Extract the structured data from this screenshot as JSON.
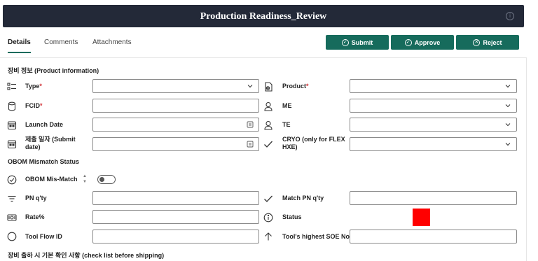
{
  "header": {
    "title": "Production Readiness_Review"
  },
  "tabs": [
    {
      "label": "Details"
    },
    {
      "label": "Comments"
    },
    {
      "label": "Attachments"
    }
  ],
  "actions": {
    "submit": "Submit",
    "approve": "Approve",
    "reject": "Reject"
  },
  "sections": {
    "product_info": "장비 정보 (Product information)",
    "obom": "OBOM Mismatch Status",
    "checklist": "장비 출하 시 기본 확인 사항 (check list before shipping)"
  },
  "fields": {
    "type": {
      "label": "Type",
      "required": "*",
      "value": ""
    },
    "product": {
      "label": "Product",
      "required": "*",
      "value": ""
    },
    "fcid": {
      "label": "FCID",
      "required": "*",
      "value": ""
    },
    "me": {
      "label": "ME",
      "value": ""
    },
    "launch_date": {
      "label": "Launch Date",
      "value": ""
    },
    "te": {
      "label": "TE",
      "value": ""
    },
    "submit_date": {
      "label": "제출 일자 (Submit date)",
      "value": ""
    },
    "cryo": {
      "label": "CRYO (only for FLEX HXE)",
      "value": ""
    },
    "obom_mismatch": {
      "label": "OBOM Mis-Match",
      "checked": false
    },
    "pn_qty": {
      "label": "PN q'ty",
      "value": ""
    },
    "match_pn_qty": {
      "label": "Match PN q'ty",
      "value": ""
    },
    "rate": {
      "label": "Rate%",
      "value": ""
    },
    "status": {
      "label": "Status",
      "color": "#ff0000"
    },
    "tool_flow_id": {
      "label": "Tool Flow ID",
      "value": ""
    },
    "tool_highest_soe": {
      "label": "Tool's highest SOE No.",
      "value": ""
    }
  },
  "colors": {
    "header_bg": "#232938",
    "accent": "#166b5c",
    "required": "#d13438"
  },
  "icons": {
    "type": "list-icon",
    "product": "gear-document-icon",
    "fcid": "database-icon",
    "me": "person-icon",
    "launch_date": "calendar-icon",
    "te": "person-icon",
    "submit_date": "calendar-icon",
    "cryo": "checkmark-icon",
    "obom": "check-circle-icon",
    "pn_qty": "filter-lines-icon",
    "match_pn_qty": "checkmark-icon",
    "rate": "money-icon",
    "status": "info-icon",
    "tool_flow_id": "circle-icon",
    "tool_highest_soe": "arrow-up-icon"
  }
}
